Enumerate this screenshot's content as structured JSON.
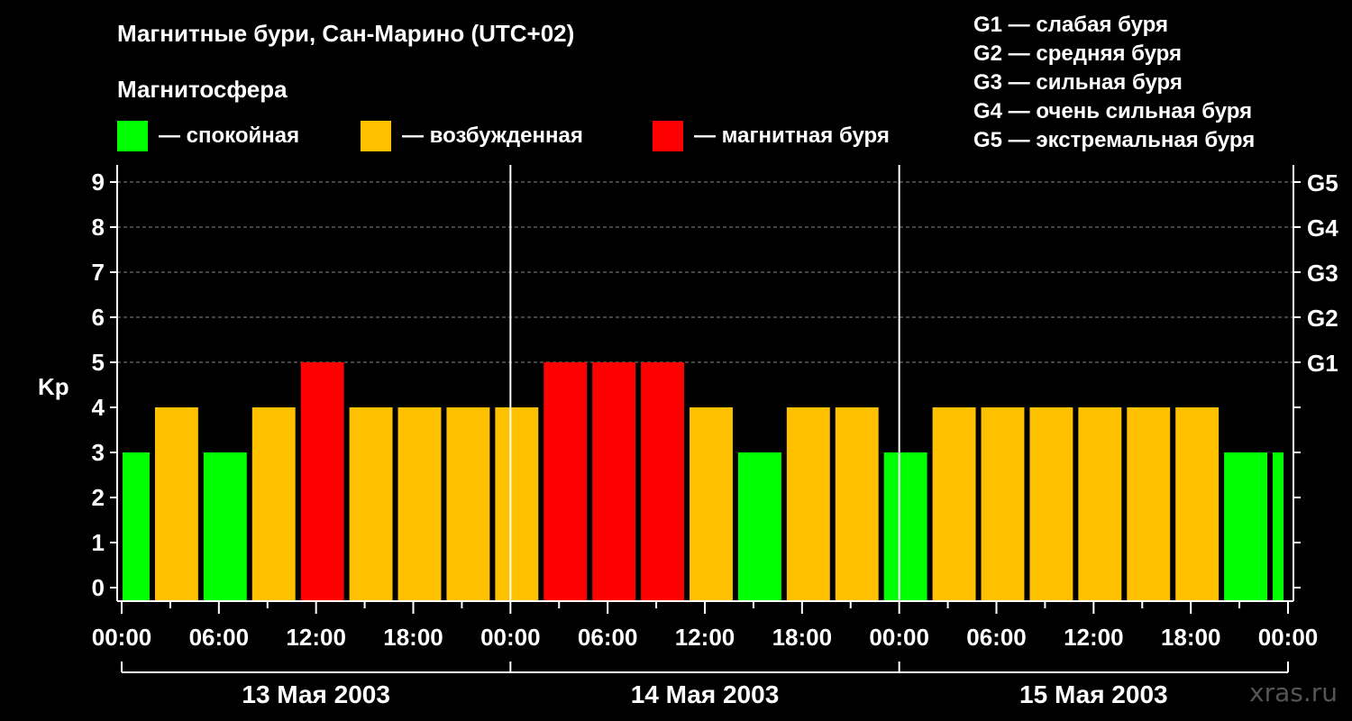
{
  "title": "Магнитные бури, Сан-Марино (UTC+02)",
  "subtitle": "Магнитосфера",
  "legend": [
    {
      "label": "— спокойная",
      "color": "#00ff00"
    },
    {
      "label": "— возбужденная",
      "color": "#ffc000"
    },
    {
      "label": "— магнитная буря",
      "color": "#ff0000"
    }
  ],
  "storm_scale": [
    "G1 — слабая буря",
    "G2 — средняя буря",
    "G3 — сильная буря",
    "G4 — очень сильная буря",
    "G5 — экстремальная буря"
  ],
  "watermark": "xras.ru",
  "colors": {
    "quiet": "#00ff00",
    "active": "#ffc000",
    "storm": "#ff0000",
    "background": "#000000",
    "grid": "#888888"
  },
  "chart_data": {
    "type": "bar",
    "ylabel": "Kp",
    "ylim": [
      0,
      9
    ],
    "yticks": [
      0,
      1,
      2,
      3,
      4,
      5,
      6,
      7,
      8,
      9
    ],
    "right_axis_labels": [
      {
        "kp": 5,
        "label": "G1"
      },
      {
        "kp": 6,
        "label": "G2"
      },
      {
        "kp": 7,
        "label": "G3"
      },
      {
        "kp": 8,
        "label": "G4"
      },
      {
        "kp": 9,
        "label": "G5"
      }
    ],
    "grid": "dashed horizontal",
    "x_tick_labels": [
      "00:00",
      "06:00",
      "12:00",
      "18:00",
      "00:00",
      "06:00",
      "12:00",
      "18:00",
      "00:00",
      "06:00",
      "12:00",
      "18:00",
      "00:00"
    ],
    "days": [
      "13 Мая 2003",
      "14 Мая 2003",
      "15 Мая 2003"
    ],
    "interval_hours": 3,
    "first_bar_hours": 2,
    "values": [
      3,
      4,
      3,
      4,
      5,
      4,
      4,
      4,
      4,
      5,
      5,
      5,
      4,
      3,
      4,
      4,
      3,
      4,
      4,
      4,
      4,
      4,
      4,
      3,
      3
    ],
    "levels": [
      "quiet",
      "active",
      "quiet",
      "active",
      "storm",
      "active",
      "active",
      "active",
      "active",
      "storm",
      "storm",
      "storm",
      "active",
      "quiet",
      "active",
      "active",
      "quiet",
      "active",
      "active",
      "active",
      "active",
      "active",
      "active",
      "quiet",
      "quiet"
    ]
  }
}
